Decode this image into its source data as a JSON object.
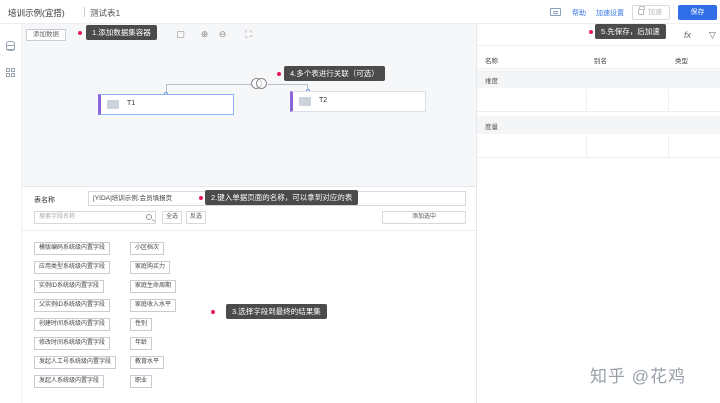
{
  "topbar": {
    "app_title": "培训示例(宜搭)",
    "tab_name": "测试表1",
    "help_label": "帮助",
    "accel_settings_label": "加速设置",
    "accel_label": "加速",
    "save_label": "保存"
  },
  "canvas": {
    "add_data_label": "添加数据",
    "nodes": [
      {
        "label": "T1"
      },
      {
        "label": "T2"
      }
    ]
  },
  "callouts": {
    "c1": "1.添加数据集容器",
    "c2": "2.键入单据页面的名称，可以拿到对应的表",
    "c3": "3.选择字段到最终的结果集",
    "c4": "4.多个表进行关联（可选）",
    "c5": "5.先保存，后加速"
  },
  "right_panel": {
    "columns": [
      "名称",
      "别名",
      "类型"
    ],
    "sections": [
      "维度",
      "度量"
    ]
  },
  "form": {
    "table_name_label": "表名称",
    "table_name_value": "[YIDA]培训示例.会员填报页",
    "search_placeholder": "搜索字段名称",
    "select_all_label": "全选",
    "invert_label": "反选",
    "add_selected_label": "添加选中"
  },
  "fields_left": [
    "模版编码系统级内置字段",
    "应用类型系统级内置字段",
    "实例ID系统级内置字段",
    "父实例ID系统级内置字段",
    "创建时间系统级内置字段",
    "修改时间系统级内置字段",
    "发起人工号系统级内置字段",
    "发起人系统级内置字段"
  ],
  "fields_right": [
    "小区档次",
    "家庭购买力",
    "家庭生命周期",
    "家庭收入水平",
    "性别",
    "年龄",
    "教育水平",
    "职业"
  ],
  "watermark": "知乎 @花鸡"
}
